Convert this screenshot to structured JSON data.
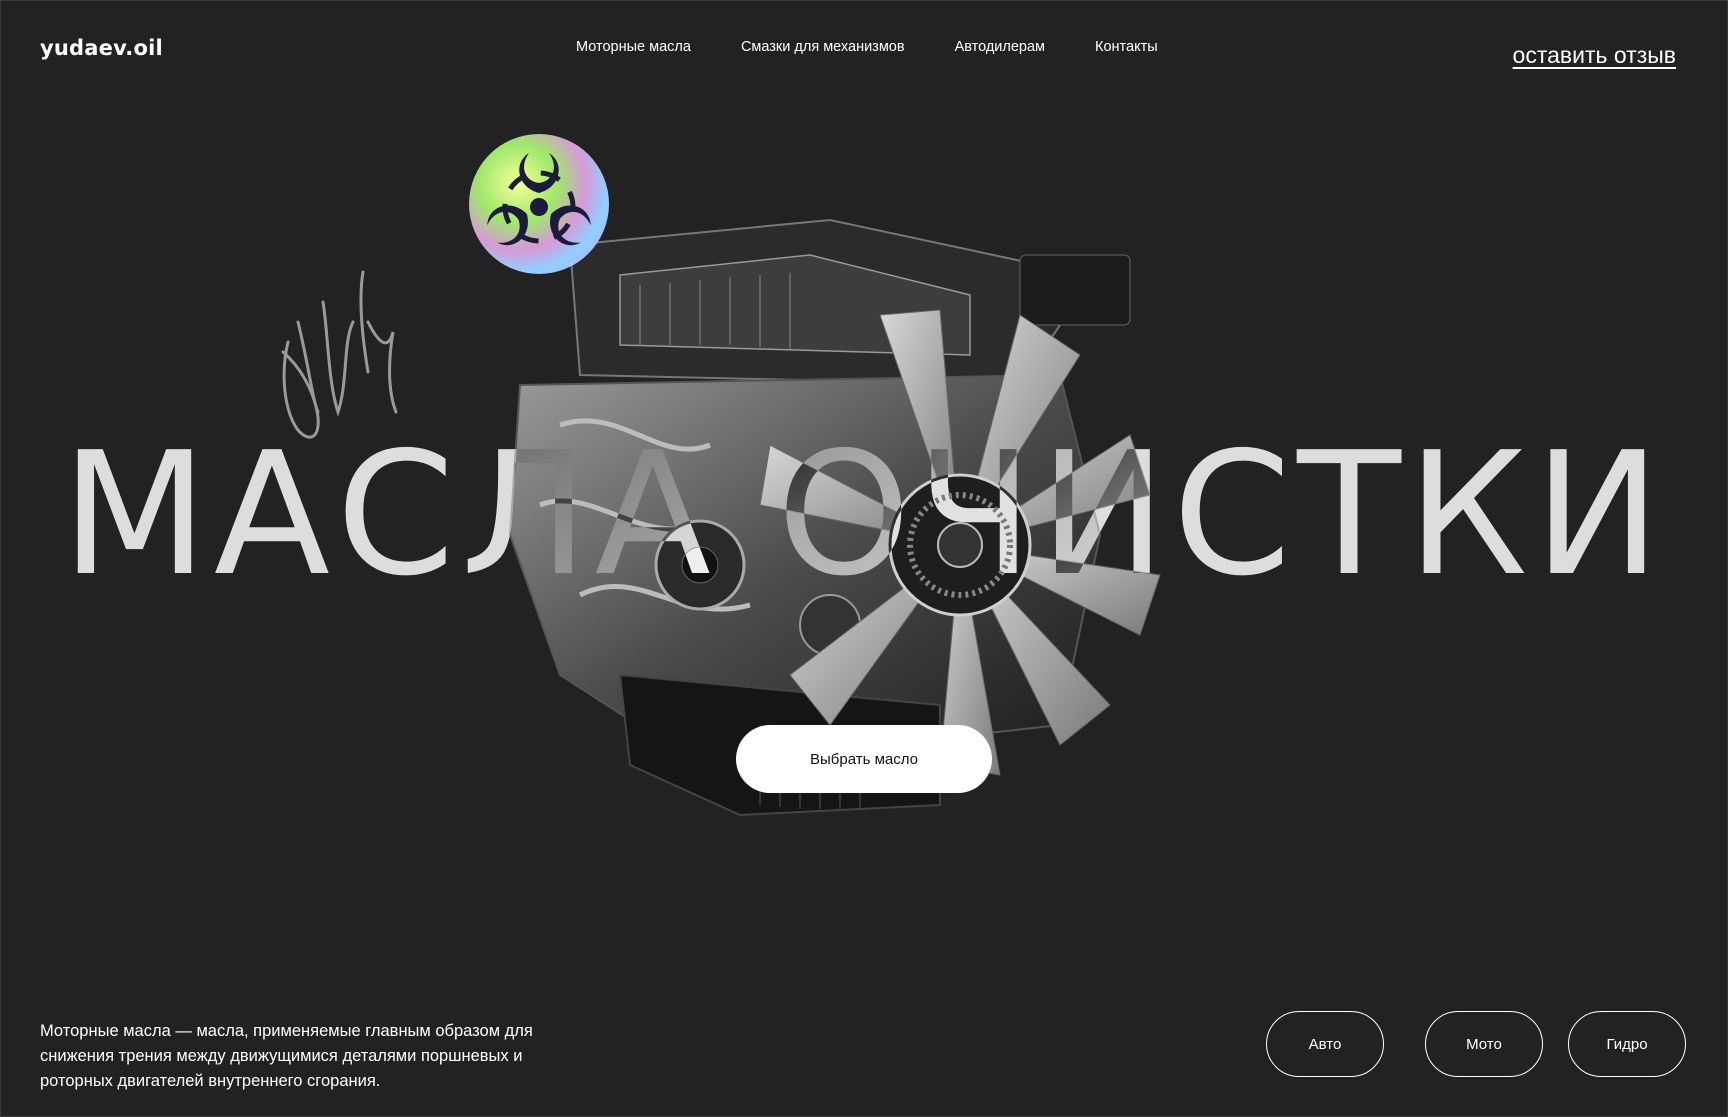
{
  "header": {
    "logo": "yudaev.oil",
    "nav": [
      {
        "label": "Моторные масла"
      },
      {
        "label": "Смазки для механизмов"
      },
      {
        "label": "Автодилерам"
      },
      {
        "label": "Контакты"
      }
    ],
    "review_link": "оставить отзыв"
  },
  "hero": {
    "headline": "МАСЛА ОЧИСТКИ",
    "cta_label": "Выбрать масло",
    "badge_icon": "biohazard-icon",
    "image": "engine-image"
  },
  "footer": {
    "description": "Моторные масла — масла, применяемые главным образом для снижения трения между движущимися деталями поршневых и роторных двигателей внутреннего сгорания.",
    "categories": [
      {
        "label": "Авто"
      },
      {
        "label": "Мото"
      },
      {
        "label": "Гидро"
      }
    ]
  },
  "colors": {
    "background": "#222222",
    "text": "#ffffff",
    "button_bg": "#ffffff",
    "button_text": "#111111"
  }
}
